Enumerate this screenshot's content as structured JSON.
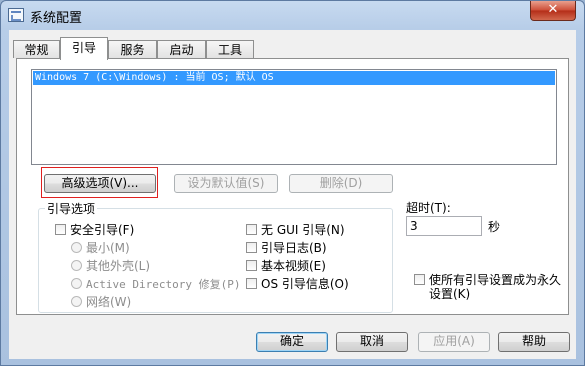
{
  "window": {
    "title": "系统配置",
    "close_label": "✕"
  },
  "tabs": [
    {
      "label": "常规"
    },
    {
      "label": "引导",
      "active": true
    },
    {
      "label": "服务"
    },
    {
      "label": "启动"
    },
    {
      "label": "工具"
    }
  ],
  "boot_list": {
    "items": [
      "Windows 7 (C:\\Windows) : 当前 OS; 默认 OS"
    ]
  },
  "boot_buttons": {
    "advanced": "高级选项(V)...",
    "set_default": "设为默认值(S)",
    "delete": "删除(D)"
  },
  "boot_options": {
    "title": "引导选项",
    "safe_boot": "安全引导(F)",
    "minimal": "最小(M)",
    "alternate_shell": "其他外壳(L)",
    "active_directory_repair": "Active Directory 修复(P)",
    "network": "网络(W)",
    "no_gui_boot": "无 GUI 引导(N)",
    "boot_log": "引导日志(B)",
    "base_video": "基本视频(E)",
    "os_boot_info": "OS 引导信息(O)"
  },
  "timeout": {
    "label": "超时(T):",
    "value": "3",
    "unit": "秒"
  },
  "make_permanent": {
    "label_line1": "使所有引导设置成为永久",
    "label_line2": "设置(K)"
  },
  "footer": {
    "ok": "确定",
    "cancel": "取消",
    "apply": "应用(A)",
    "help": "帮助"
  },
  "colors": {
    "selection": "#3399ff",
    "focus_highlight": "#e02020",
    "title_bar": "#b7cde8"
  }
}
